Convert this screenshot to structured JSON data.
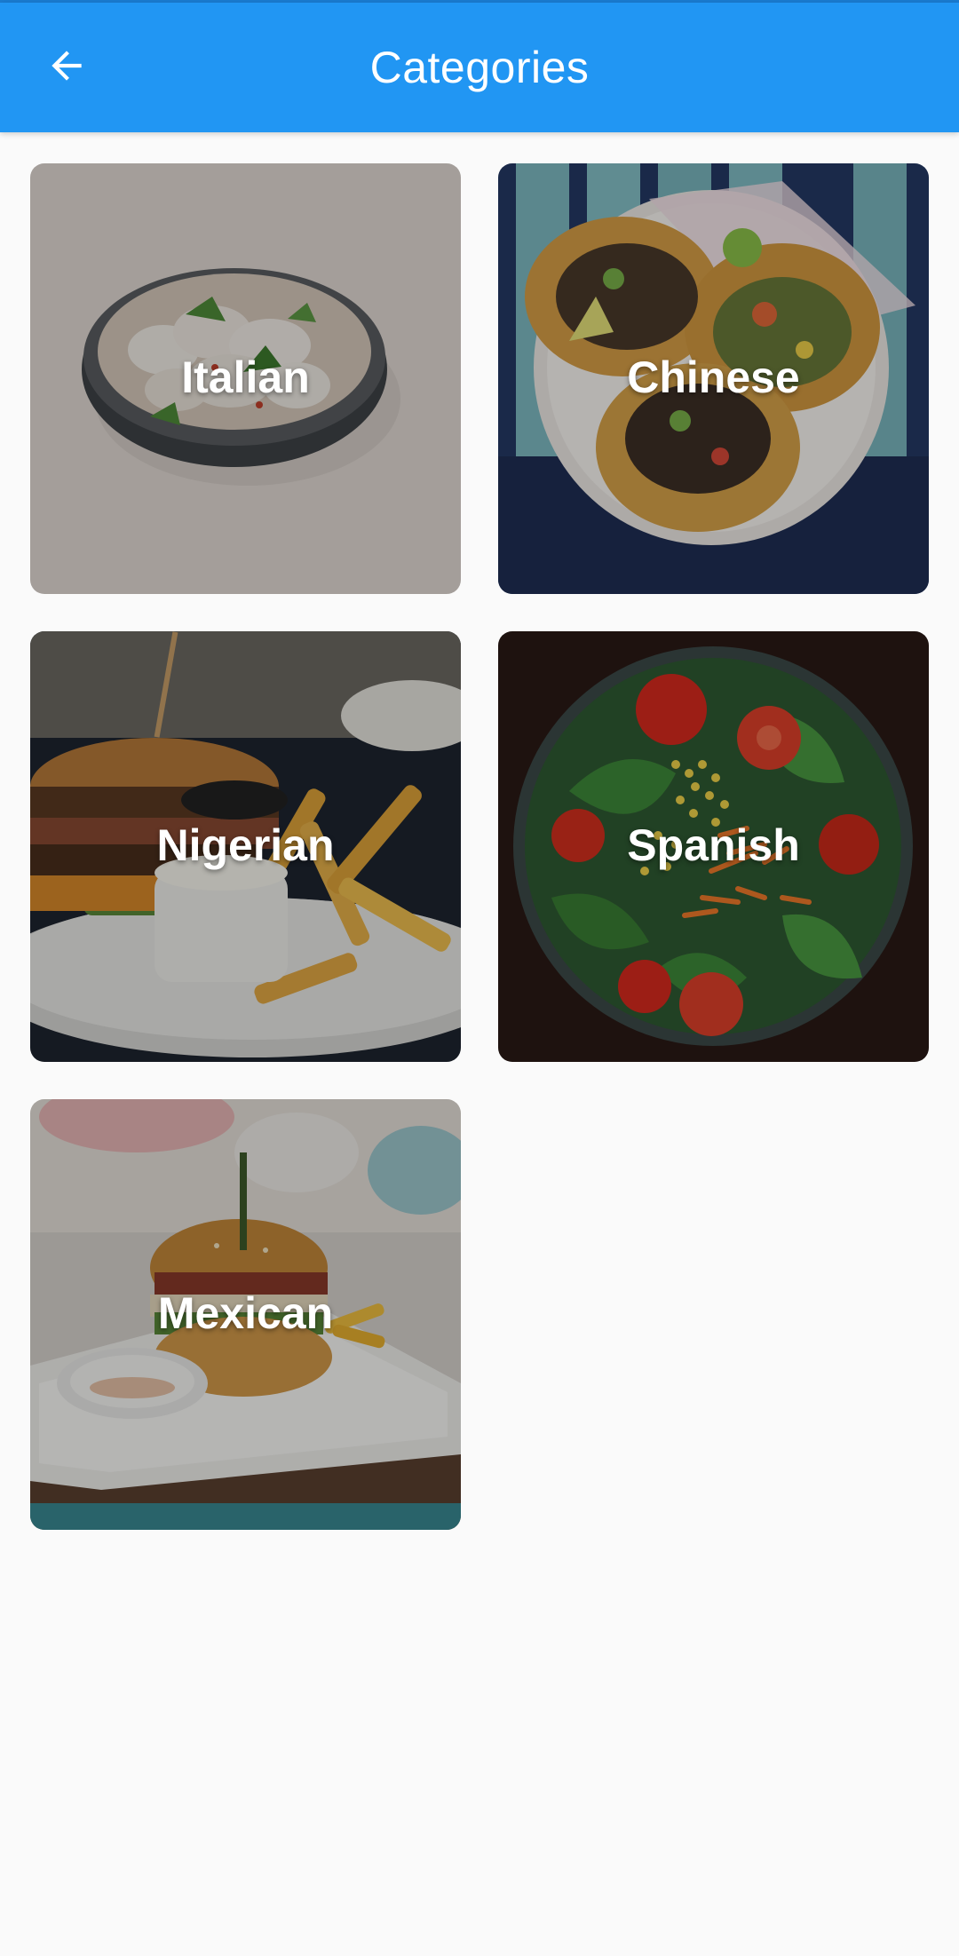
{
  "app_bar": {
    "title": "Categories",
    "back_icon": "arrow-left-icon",
    "color": "#2196f3"
  },
  "categories": [
    {
      "label": "Italian",
      "image": "dumplings-bowl"
    },
    {
      "label": "Chinese",
      "image": "tacos-plate"
    },
    {
      "label": "Nigerian",
      "image": "burger-fries"
    },
    {
      "label": "Spanish",
      "image": "salad-bowl"
    },
    {
      "label": "Mexican",
      "image": "burger-plate"
    }
  ]
}
